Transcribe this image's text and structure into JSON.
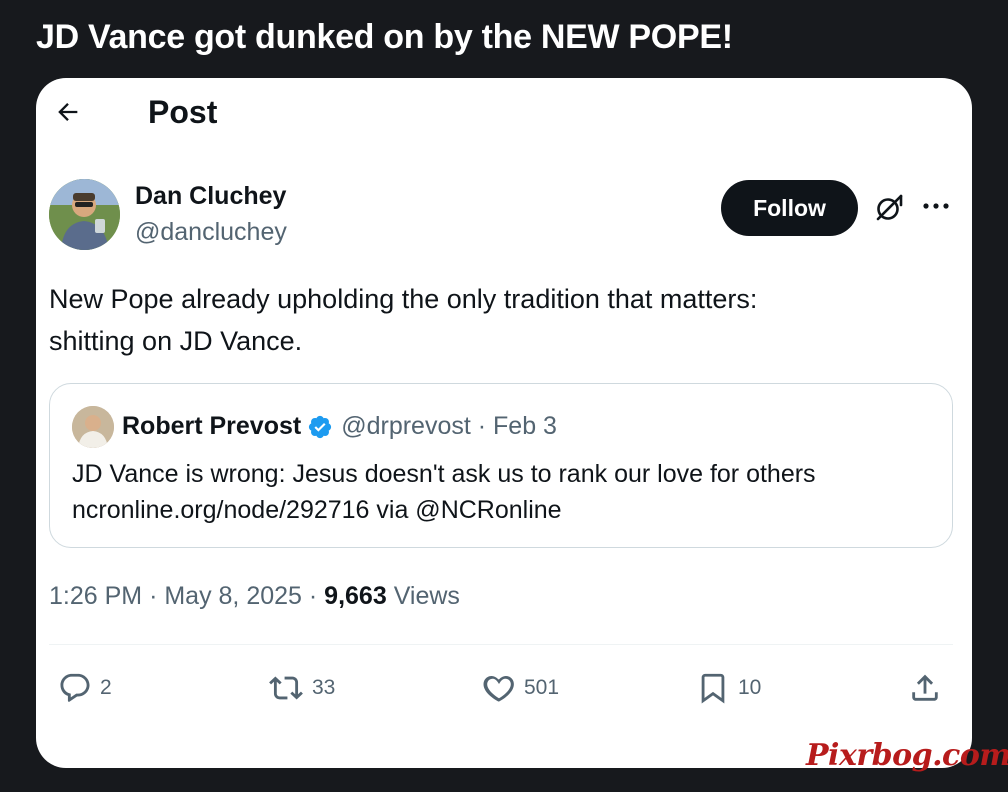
{
  "headline": "JD Vance got dunked on by the NEW POPE!",
  "topbar": {
    "back_icon": "arrow-left-icon",
    "title": "Post"
  },
  "author": {
    "name": "Dan Cluchey",
    "handle": "@dancluchey"
  },
  "follow_label": "Follow",
  "tweet": {
    "lines": [
      "New Pope already upholding the only tradition that matters:",
      "shitting on JD Vance."
    ]
  },
  "quote": {
    "name": "Robert Prevost",
    "handle": "@drprevost",
    "date": "Feb 3",
    "meta": "@drprevost · Feb 3",
    "lines": [
      "JD Vance is wrong: Jesus doesn't ask us to rank our love for others",
      "ncronline.org/node/292716 via @NCRonline"
    ]
  },
  "meta": {
    "time": "1:26 PM",
    "date": "May 8, 2025",
    "views_count": "9,663",
    "views_label": "Views"
  },
  "actions": {
    "replies": "2",
    "reposts": "33",
    "likes": "501",
    "bookmarks": "10"
  },
  "colors": {
    "verified": "#1d9bf0",
    "text_primary": "#0f1419",
    "text_secondary": "#536471",
    "background": "#17191d",
    "watermark": "#b71c1c"
  },
  "watermark": "Pixrbog.com"
}
